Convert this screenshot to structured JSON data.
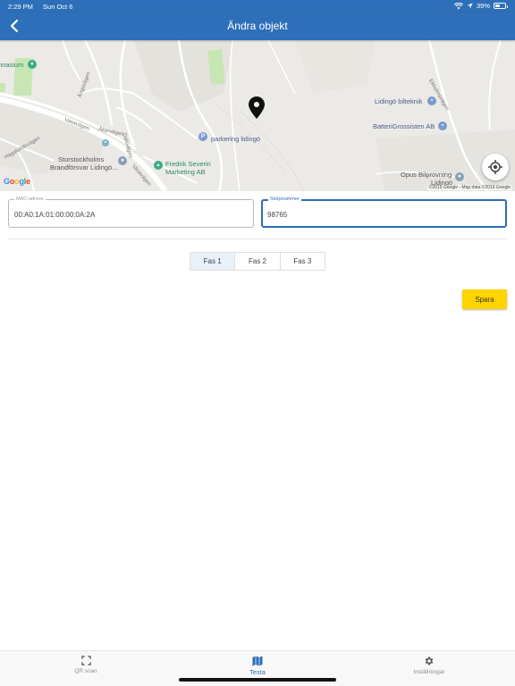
{
  "status_bar": {
    "time": "2:29 PM",
    "date": "Sun Oct 6",
    "battery": "39%",
    "battery_level": 0.39,
    "icons": [
      "wifi-icon",
      "location-arrow-icon",
      "battery-icon"
    ]
  },
  "nav": {
    "title": "Ändra objekt",
    "back_icon": "chevron-left-icon"
  },
  "map": {
    "labels": {
      "gymnasium": "nnasium",
      "lidingo_bilteknik": "Lidingö bilteknik",
      "batterigrossisten": "BatteriGrossisten AB",
      "parkering": "parkering lidingö",
      "fredrik_severin_1": "Fredrik Severin",
      "fredrik_severin_2": "Marketing AB",
      "storstockholms_1": "Storstockholms",
      "storstockholms_2": "Brandförsvar Lidingö...",
      "opus_1": "Opus Bilprovning",
      "opus_2": "Lidingö",
      "vasavagen_1": "Vasavägen",
      "vasavagen_2": "Vasavägen",
      "akervagen": "Åkervägen",
      "angsvagen": "Ängsvägen",
      "ekholmsvagen": "Ekholmsvägen",
      "dalsvagen": "Dalsvägen",
      "hagalundsvagen": "Hagalundsvägen"
    },
    "google": [
      "G",
      "o",
      "o",
      "g",
      "l",
      "e"
    ],
    "attribution": "©2019 Google - Map data ©2019 Google",
    "poi_parking_glyph": "P",
    "colors": {
      "land": "#eceae6",
      "road": "#ffffff",
      "park": "#c6e6b4",
      "poi_blue": "#7b9ad0",
      "poi_green": "#3bab87",
      "marker": "#111111"
    }
  },
  "form": {
    "mac": {
      "label": "MAC-adress",
      "value": "00:A0:1A:01:00:00:0A:2A"
    },
    "stolp": {
      "label": "Stolpnummer",
      "value": "98765"
    },
    "phases": [
      {
        "label": "Fas 1",
        "active": true
      },
      {
        "label": "Fas 2",
        "active": false
      },
      {
        "label": "Fas 3",
        "active": false
      }
    ],
    "save_label": "Spara"
  },
  "tabs": [
    {
      "label": "QR scan",
      "icon": "qr-scan-icon",
      "active": false
    },
    {
      "label": "Testa",
      "icon": "map-icon",
      "active": true
    },
    {
      "label": "Inställningar",
      "icon": "gear-icon",
      "active": false
    }
  ],
  "colors": {
    "brand": "#2d6fb8",
    "save": "#ffd400",
    "segment_active": "#e8f0f9"
  }
}
